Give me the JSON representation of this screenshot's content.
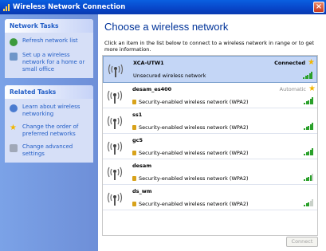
{
  "window": {
    "title": "Wireless Network Connection"
  },
  "sidebar": {
    "network_tasks": {
      "header": "Network Tasks",
      "items": [
        {
          "label": "Refresh network list",
          "icon": "refresh-icon"
        },
        {
          "label": "Set up a wireless network for a home or small office",
          "icon": "setup-network-icon"
        }
      ]
    },
    "related_tasks": {
      "header": "Related Tasks",
      "items": [
        {
          "label": "Learn about wireless networking",
          "icon": "info-icon"
        },
        {
          "label": "Change the order of preferred networks",
          "icon": "star-icon"
        },
        {
          "label": "Change advanced settings",
          "icon": "settings-icon"
        }
      ]
    }
  },
  "main": {
    "title": "Choose a wireless network",
    "description": "Click an item in the list below to connect to a wireless network in range or to get more information."
  },
  "networks": [
    {
      "ssid": "XCA-UTW1",
      "security": "Unsecured wireless network",
      "status": "Connected",
      "secured": false,
      "starred": true,
      "signal": 5
    },
    {
      "ssid": "desam_es400",
      "security": "Security-enabled wireless network (WPA2)",
      "status": "Automatic",
      "secured": true,
      "starred": true,
      "signal": 5
    },
    {
      "ssid": "ss1",
      "security": "Security-enabled wireless network (WPA2)",
      "status": "",
      "secured": true,
      "starred": false,
      "signal": 5
    },
    {
      "ssid": "gc5",
      "security": "Security-enabled wireless network (WPA2)",
      "status": "",
      "secured": true,
      "starred": false,
      "signal": 5
    },
    {
      "ssid": "desam",
      "security": "Security-enabled wireless network (WPA2)",
      "status": "",
      "secured": true,
      "starred": false,
      "signal": 4
    },
    {
      "ssid": "ds_wm",
      "security": "Security-enabled wireless network (WPA2)",
      "status": "",
      "secured": true,
      "starred": false,
      "signal": 3
    }
  ],
  "buttons": {
    "connect": "Connect"
  },
  "colors": {
    "title_blue": "#003399",
    "link_blue": "#215dc6",
    "selected_bg": "#c4d6f6",
    "signal_green": "#2aa02a"
  }
}
